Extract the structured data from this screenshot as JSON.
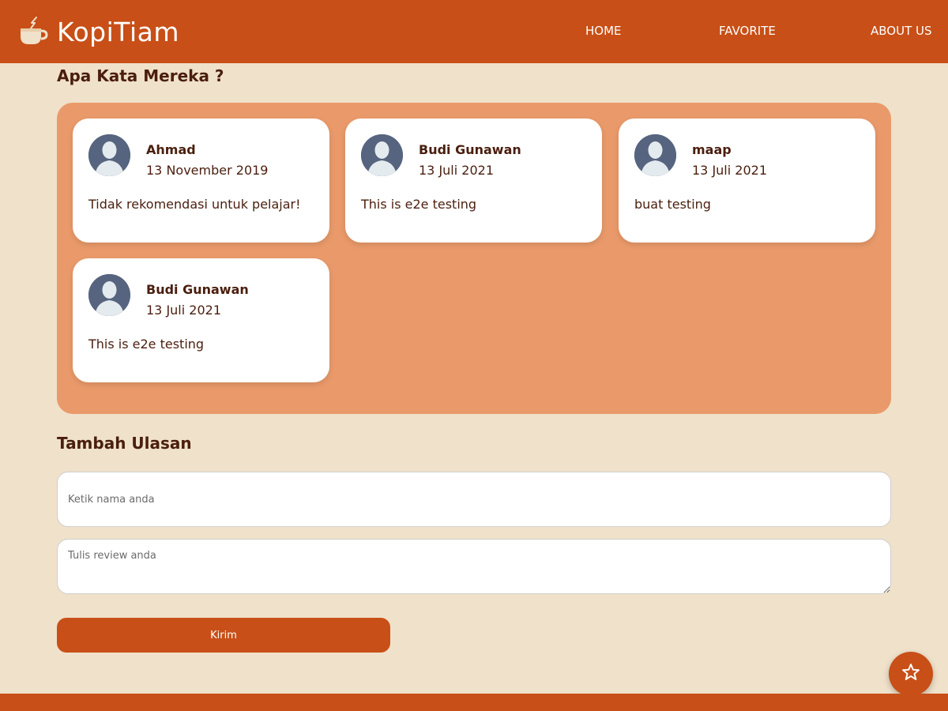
{
  "navbar": {
    "brand": "KopiTiam",
    "logo_icon": "coffee-cup-icon",
    "links": [
      {
        "label": "HOME"
      },
      {
        "label": "FAVORITE"
      },
      {
        "label": "ABOUT US"
      }
    ]
  },
  "reviews_section": {
    "title": "Apa Kata Mereka ?",
    "reviews": [
      {
        "name": "Ahmad",
        "date": "13 November 2019",
        "text": "Tidak rekomendasi untuk pelajar!"
      },
      {
        "name": "Budi Gunawan",
        "date": "13 Juli 2021",
        "text": "This is e2e testing"
      },
      {
        "name": "maap",
        "date": "13 Juli 2021",
        "text": "buat testing"
      },
      {
        "name": "Budi Gunawan",
        "date": "13 Juli 2021",
        "text": "This is e2e testing"
      }
    ]
  },
  "form": {
    "title": "Tambah Ulasan",
    "name_placeholder": "Ketik nama anda",
    "name_value": "",
    "review_placeholder": "Tulis review anda",
    "review_value": "",
    "submit_label": "Kirim"
  },
  "fab": {
    "icon": "star-icon"
  },
  "colors": {
    "primary": "#c84f17",
    "background": "#f0e1ca",
    "panel": "#ea9a6a",
    "text": "#4a1e0e"
  }
}
